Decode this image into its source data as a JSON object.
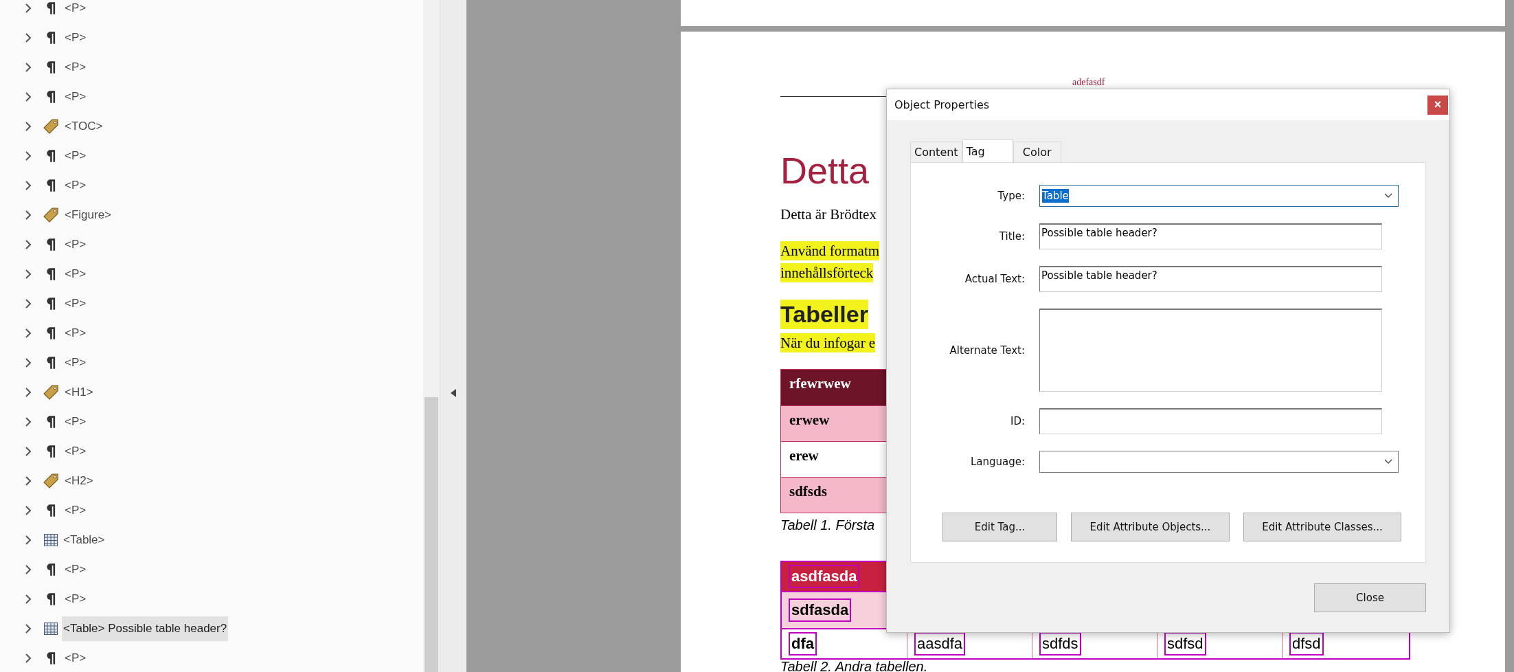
{
  "tree": {
    "items": [
      {
        "kind": "paragraph",
        "label": "<P>",
        "selected": false
      },
      {
        "kind": "paragraph",
        "label": "<P>",
        "selected": false
      },
      {
        "kind": "paragraph",
        "label": "<P>",
        "selected": false
      },
      {
        "kind": "paragraph",
        "label": "<P>",
        "selected": false
      },
      {
        "kind": "tag",
        "label": "<TOC>",
        "selected": false
      },
      {
        "kind": "paragraph",
        "label": "<P>",
        "selected": false
      },
      {
        "kind": "paragraph",
        "label": "<P>",
        "selected": false
      },
      {
        "kind": "tag",
        "label": "<Figure>",
        "selected": false
      },
      {
        "kind": "paragraph",
        "label": "<P>",
        "selected": false
      },
      {
        "kind": "paragraph",
        "label": "<P>",
        "selected": false
      },
      {
        "kind": "paragraph",
        "label": "<P>",
        "selected": false
      },
      {
        "kind": "paragraph",
        "label": "<P>",
        "selected": false
      },
      {
        "kind": "paragraph",
        "label": "<P>",
        "selected": false
      },
      {
        "kind": "tag",
        "label": "<H1>",
        "selected": false
      },
      {
        "kind": "paragraph",
        "label": "<P>",
        "selected": false
      },
      {
        "kind": "paragraph",
        "label": "<P>",
        "selected": false
      },
      {
        "kind": "tag",
        "label": "<H2>",
        "selected": false
      },
      {
        "kind": "paragraph",
        "label": "<P>",
        "selected": false
      },
      {
        "kind": "table",
        "label": "<Table>",
        "selected": false
      },
      {
        "kind": "paragraph",
        "label": "<P>",
        "selected": false
      },
      {
        "kind": "paragraph",
        "label": "<P>",
        "selected": false
      },
      {
        "kind": "table",
        "label": "<Table> Possible table header?",
        "selected": true
      },
      {
        "kind": "paragraph",
        "label": "<P>",
        "selected": false
      }
    ]
  },
  "document": {
    "header": "adefasdf",
    "title": "Detta",
    "body": "Detta är Brödtex",
    "highlighted_lines": [
      "Använd formatm",
      "innehållsförteck"
    ],
    "heading": "Tabeller",
    "heading_note": "När du infogar e",
    "table_1": {
      "rows": [
        {
          "kind": "header",
          "cells": [
            "rfewrwew"
          ]
        },
        {
          "kind": "shaded",
          "cells": [
            "erwew"
          ]
        },
        {
          "kind": "plain",
          "cells": [
            "erew"
          ]
        },
        {
          "kind": "shaded",
          "cells": [
            "sdfsds"
          ]
        }
      ],
      "caption": "Tabell 1. Första"
    },
    "table_2": {
      "rows": [
        {
          "kind": "header",
          "cells": [
            "asdfasda"
          ]
        },
        {
          "kind": "shaded",
          "cells": [
            "sdfasda"
          ]
        },
        {
          "kind": "plain",
          "cells": [
            "dfa",
            "aasdfa",
            "sdfds",
            "sdfsd",
            "dfsd"
          ]
        }
      ],
      "caption": "Tabell 2. Andra tabellen."
    }
  },
  "dialog": {
    "title": "Object Properties",
    "close_icon": "×",
    "tabs": [
      {
        "label": "Content",
        "selected": false
      },
      {
        "label": "Tag",
        "selected": true
      },
      {
        "label": "Color",
        "selected": false
      }
    ],
    "fields": [
      {
        "kind": "dropdown",
        "label": "Type:",
        "value": "Table"
      },
      {
        "kind": "text",
        "label": "Title:",
        "value": "Possible table header?"
      },
      {
        "kind": "text",
        "label": "Actual Text:",
        "value": "Possible table header?"
      },
      {
        "kind": "textarea",
        "label": "Alternate Text:"
      },
      {
        "kind": "text",
        "label": "ID:"
      },
      {
        "kind": "dropdown",
        "label": "Language:"
      }
    ],
    "buttons": [
      "Edit Tag...",
      "Edit Attribute Objects...",
      "Edit Attribute Classes..."
    ],
    "close_button": "Close"
  }
}
